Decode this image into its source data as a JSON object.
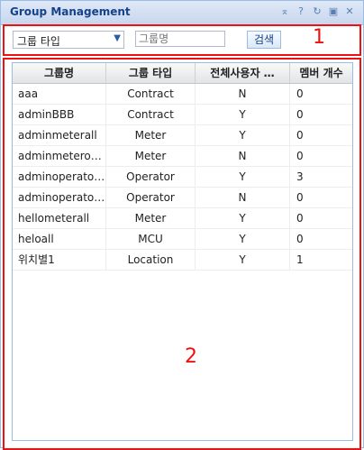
{
  "panel": {
    "title": "Group Management",
    "tools": [
      "collapse-up-icon",
      "help-icon",
      "refresh-icon",
      "maximize-icon",
      "close-icon"
    ]
  },
  "search": {
    "type_select": "그룹 타입",
    "name_placeholder": "그룹명",
    "search_button": "검색"
  },
  "annotations": {
    "search_area": "1",
    "grid_area": "2"
  },
  "grid": {
    "columns": [
      "그룹명",
      "그룹 타입",
      "전체사용자 …",
      "멤버 개수"
    ],
    "rows": [
      [
        "aaa",
        "Contract",
        "N",
        "0"
      ],
      [
        "adminBBB",
        "Contract",
        "Y",
        "0"
      ],
      [
        "adminmeterall",
        "Meter",
        "Y",
        "0"
      ],
      [
        "adminmeteronly",
        "Meter",
        "N",
        "0"
      ],
      [
        "adminoperatorall",
        "Operator",
        "Y",
        "3"
      ],
      [
        "adminoperator…",
        "Operator",
        "N",
        "0"
      ],
      [
        "hellometerall",
        "Meter",
        "Y",
        "0"
      ],
      [
        "heloall",
        "MCU",
        "Y",
        "0"
      ],
      [
        "위치별1",
        "Location",
        "Y",
        "1"
      ]
    ]
  },
  "colors": {
    "accent": "#15428b",
    "border": "#99bbe8",
    "annotation": "#ee1111"
  }
}
